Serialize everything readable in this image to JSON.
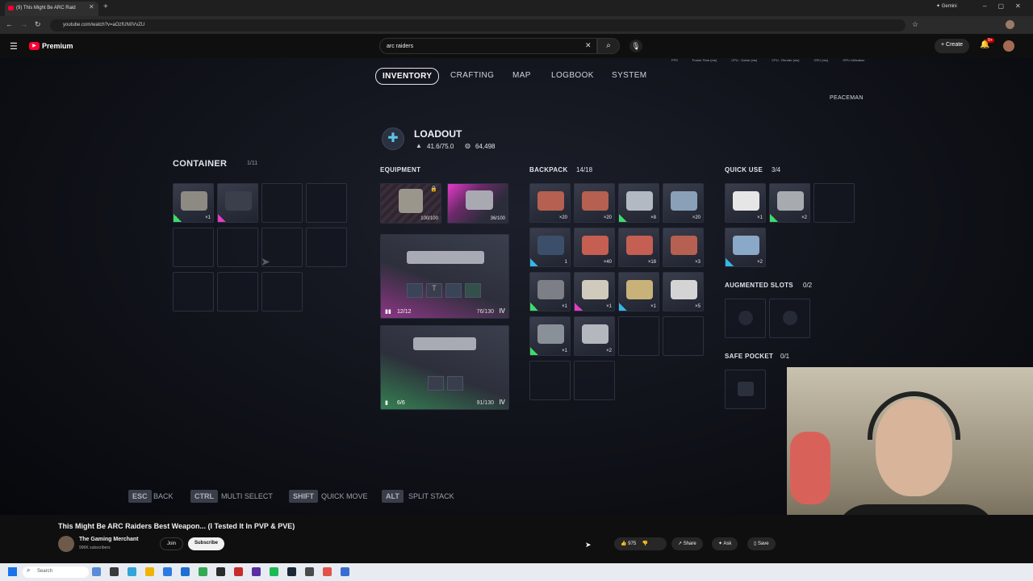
{
  "browser": {
    "tab_title": "(9) This Might Be ARC Raid",
    "url": "youtube.com/watch?v=aOzfUN0VvZU",
    "gemini_label": "Gemini"
  },
  "youtube": {
    "logo_label": "Premium",
    "search_value": "arc raiders",
    "create_label": "Create",
    "notif_count": "9+",
    "video_title": "This Might Be ARC Raiders Best Weapon... (I Tested It In PVP & PVE)",
    "channel_name": "The Gaming Merchant",
    "subscribers": "996K subscribers",
    "join_label": "Join",
    "subscribe_label": "Subscribe",
    "likes": "975",
    "share_label": "Share",
    "ask_label": "Ask",
    "save_label": "Save"
  },
  "perf_overlay": [
    "FPS",
    "Frame Time (ms)",
    "CPU - Game (ms)",
    "CPU - Render (ms)",
    "GPU (ms)",
    "GPU Utilization"
  ],
  "game": {
    "tabs": [
      "INVENTORY",
      "CRAFTING",
      "MAP",
      "LOGBOOK",
      "SYSTEM"
    ],
    "player_name": "PEACEMAN",
    "loadout_title": "LOADOUT",
    "weight": "41.6/75.0",
    "currency": "64,498",
    "container": {
      "title": "CONTAINER",
      "count": "1/11",
      "items": [
        {
          "qty": "×1"
        }
      ]
    },
    "equipment": {
      "title": "EQUIPMENT",
      "augment_durability": "100/100",
      "shield_durability": "36/100",
      "weapon1_ammo": "12/12",
      "weapon1_durability": "76/130",
      "weapon1_tier": "IV",
      "weapon2_ammo": "6/6",
      "weapon2_durability": "91/130",
      "weapon2_tier": "IV"
    },
    "backpack": {
      "title": "BACKPACK",
      "count": "14/18",
      "qtys": [
        "×20",
        "×20",
        "×8",
        "×20",
        "1",
        "×40",
        "×18",
        "×3",
        "×1",
        "×1",
        "×1",
        "×5",
        "×1",
        "×2"
      ]
    },
    "quick_use": {
      "title": "QUICK USE",
      "count": "3/4",
      "qtys": [
        "×1",
        "×2",
        "×2"
      ]
    },
    "augmented_slots": {
      "title": "AUGMENTED SLOTS",
      "count": "0/2"
    },
    "safe_pocket": {
      "title": "SAFE POCKET",
      "count": "0/1"
    },
    "hints": [
      {
        "key": "ESC",
        "label": "BACK"
      },
      {
        "key": "CTRL",
        "label": "MULTI SELECT"
      },
      {
        "key": "SHIFT",
        "label": "QUICK MOVE"
      },
      {
        "key": "ALT",
        "label": "SPLIT STACK"
      }
    ]
  },
  "taskbar": {
    "search_placeholder": "Search"
  },
  "colors": {
    "green": "#3ddc6a",
    "magenta": "#e43cc8",
    "cyan": "#34b8e8",
    "bg": "#0f0f0f"
  }
}
